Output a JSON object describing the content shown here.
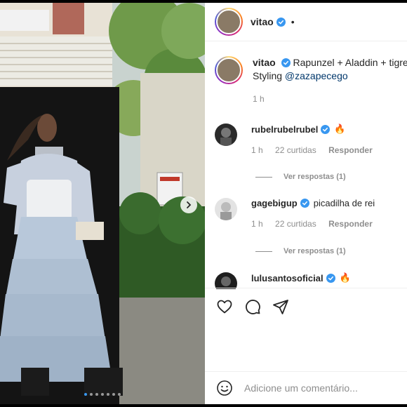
{
  "post": {
    "username": "vitao",
    "header_bullet": "•",
    "caption_line1": "Rapunzel + Aladdin + tigre",
    "caption_prefix": "Styling",
    "caption_mention": "@zazapecego",
    "time": "1 h",
    "carousel_dots": 7,
    "carousel_active_index": 0
  },
  "comments": [
    {
      "username": "rubelrubelrubel",
      "text": "",
      "emoji": "🔥",
      "time": "1 h",
      "likes": "22 curtidas",
      "reply_label": "Responder",
      "view_replies": "Ver respostas (1)",
      "verified": true
    },
    {
      "username": "gagebigup",
      "text": "picadilha de rei",
      "emoji": "",
      "time": "1 h",
      "likes": "22 curtidas",
      "reply_label": "Responder",
      "view_replies": "Ver respostas (1)",
      "verified": true
    },
    {
      "username": "lulusantosoficial",
      "text": "",
      "emoji": "🔥",
      "verified": true
    }
  ],
  "icons": {
    "like": "heart-icon",
    "comment": "comment-icon",
    "share": "share-icon",
    "emoji": "emoji-icon",
    "verified": "verified-badge-icon",
    "next": "chevron-right-icon"
  },
  "composer": {
    "placeholder": "Adicione um comentário..."
  },
  "colors": {
    "verified": "#3897f0",
    "link": "#00376b",
    "muted": "#8e8e8e",
    "text": "#262626"
  }
}
